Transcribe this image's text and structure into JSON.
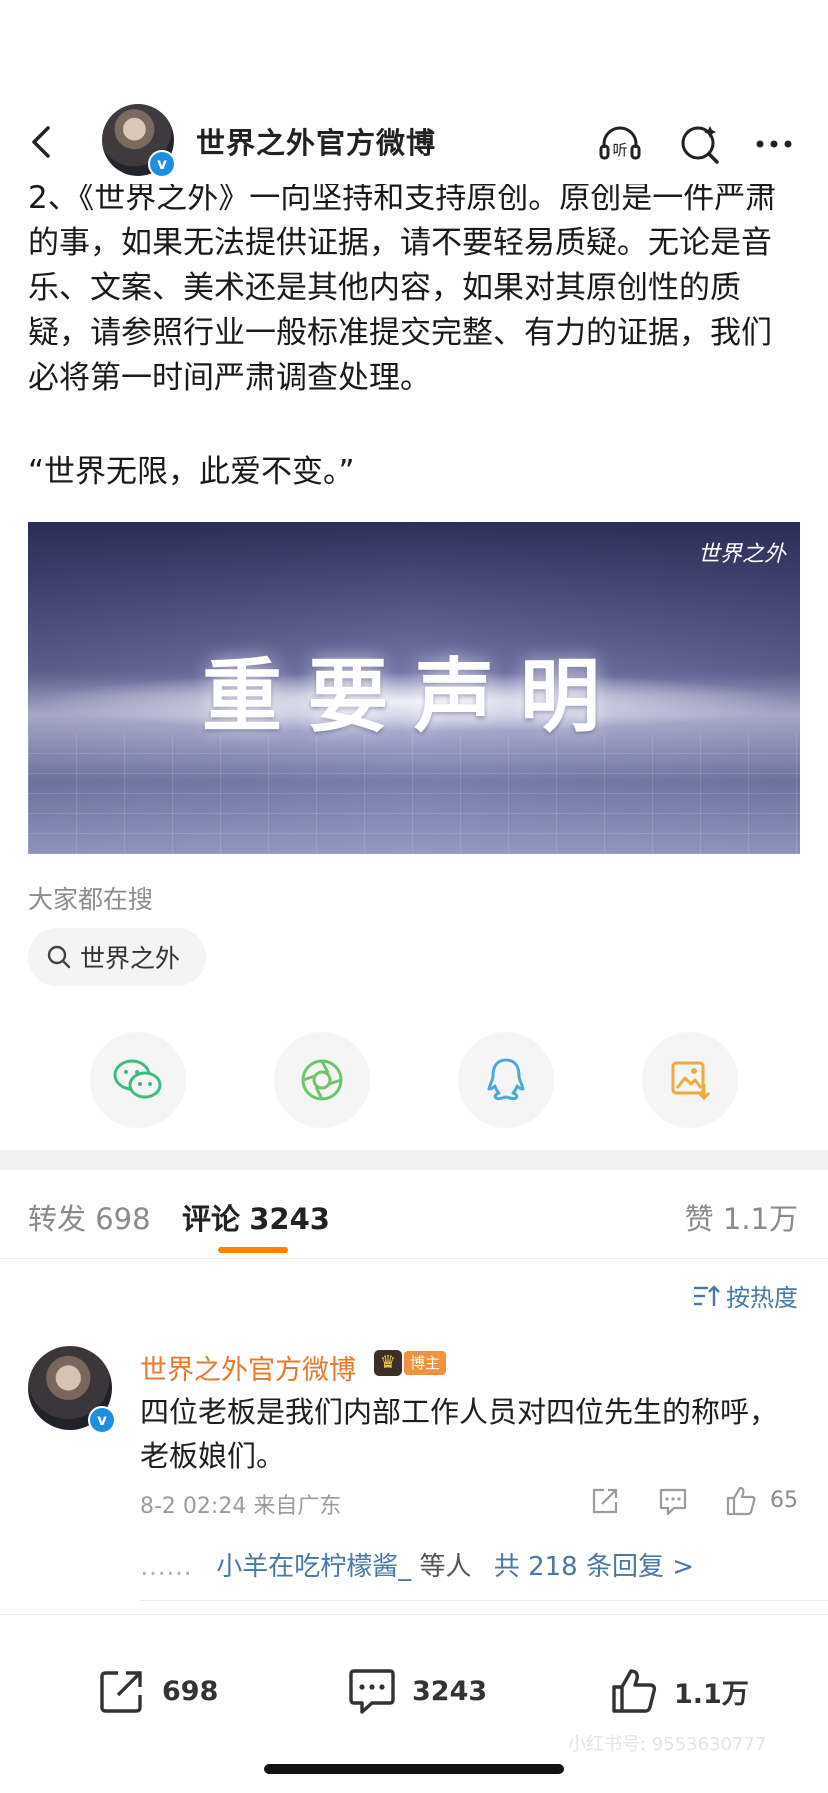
{
  "header": {
    "title": "世界之外官方微博",
    "verified_mark": "v",
    "listen_label": "听"
  },
  "post": {
    "paragraph_2": "2、《世界之外》一向坚持和支持原创。原创是一件严肃的事，如果无法提供证据，请不要轻易质疑。无论是音乐、文案、美术还是其他内容，如果对其原创性的质疑，请参照行业一般标准提交完整、有力的证据，我们必将第一时间严肃调查处理。",
    "quote": "“世界无限，此爱不变。”",
    "banner_title": "重要声明",
    "banner_logo": "世界之外"
  },
  "search": {
    "hint": "大家都在搜",
    "chip": "世界之外"
  },
  "share": {
    "icons": [
      "wechat-icon",
      "moments-icon",
      "qq-icon",
      "save-image-icon"
    ],
    "colors": {
      "wechat": "#3dbd7d",
      "moments": "#6bc56b",
      "qq": "#4aa8e0",
      "save": "#f0a93a"
    }
  },
  "tabs": {
    "repost_label": "转发",
    "repost_count": "698",
    "comment_label": "评论",
    "comment_count": "3243",
    "like_label": "赞",
    "like_count": "1.1万"
  },
  "sort_label": "按热度",
  "comment": {
    "author": "世界之外官方微博",
    "author_tag": "博主",
    "text": "四位老板是我们内部工作人员对四位先生的称呼，老板娘们。",
    "time": "8-2 02:24",
    "location": "来自广东",
    "likes": "65",
    "reply_dots": "……",
    "reply_user": "小羊在吃柠檬酱_",
    "reply_etc": "等人",
    "reply_total": "共 218 条回复 >"
  },
  "bottom_bar": {
    "repost": "698",
    "comment": "3243",
    "like": "1.1万"
  },
  "watermark": "小红书号: 9553630777"
}
